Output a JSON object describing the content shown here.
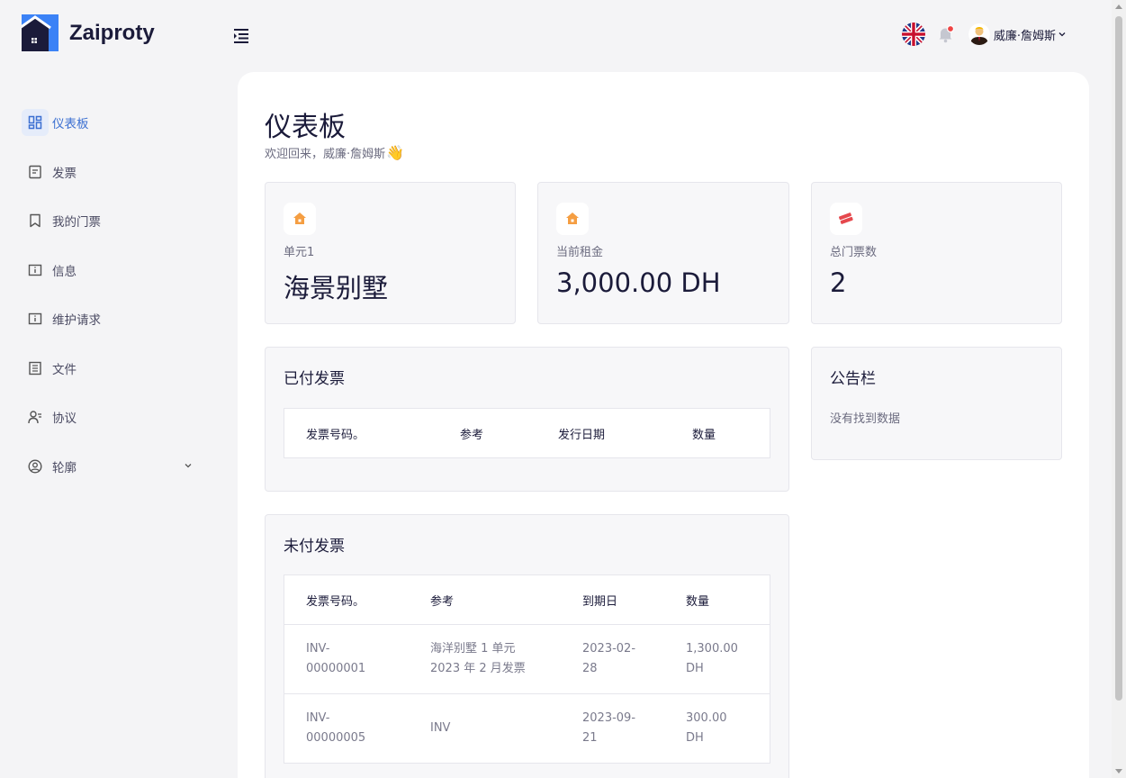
{
  "app": {
    "name": "Zaiproty"
  },
  "header": {
    "user_name": "威廉·詹姆斯"
  },
  "sidebar": {
    "items": [
      {
        "label": "仪表板",
        "icon": "dashboard-icon",
        "active": true
      },
      {
        "label": "发票",
        "icon": "invoice-icon"
      },
      {
        "label": "我的门票",
        "icon": "ticket-icon"
      },
      {
        "label": "信息",
        "icon": "info-icon"
      },
      {
        "label": "维护请求",
        "icon": "maintenance-icon"
      },
      {
        "label": "文件",
        "icon": "document-icon"
      },
      {
        "label": "协议",
        "icon": "agreement-icon"
      },
      {
        "label": "轮廓",
        "icon": "profile-icon"
      }
    ]
  },
  "main": {
    "title": "仪表板",
    "welcome": "欢迎回来，威廉·詹姆斯",
    "welcome_emoji": "👋",
    "stats": [
      {
        "label": "单元1",
        "value": "海景别墅",
        "icon": "home-icon"
      },
      {
        "label": "当前租金",
        "value": "3,000.00 DH",
        "icon": "home-icon"
      },
      {
        "label": "总门票数",
        "value": "2",
        "icon": "tickets-icon"
      }
    ],
    "paid_invoices": {
      "title": "已付发票",
      "columns": [
        "发票号码。",
        "参考",
        "发行日期",
        "数量"
      ]
    },
    "notice_board": {
      "title": "公告栏",
      "empty": "没有找到数据"
    },
    "unpaid_invoices": {
      "title": "未付发票",
      "columns": [
        "发票号码。",
        "参考",
        "到期日",
        "数量"
      ],
      "rows": [
        {
          "number": "INV-\n00000001",
          "reference": "海洋别墅 1 单元\n2023 年 2 月发票",
          "due": "2023-02-\n28",
          "amount": "1,300.00\nDH"
        },
        {
          "number": "INV-\n00000005",
          "reference": "INV",
          "due": "2023-09-\n21",
          "amount": "300.00\nDH"
        }
      ]
    }
  },
  "colors": {
    "accent": "#3b6fd1",
    "logo_blue": "#3b82f6",
    "logo_navy": "#1b1b3a",
    "stat_icon_orange": "#f59e42",
    "stat_icon_red": "#e5484d"
  }
}
